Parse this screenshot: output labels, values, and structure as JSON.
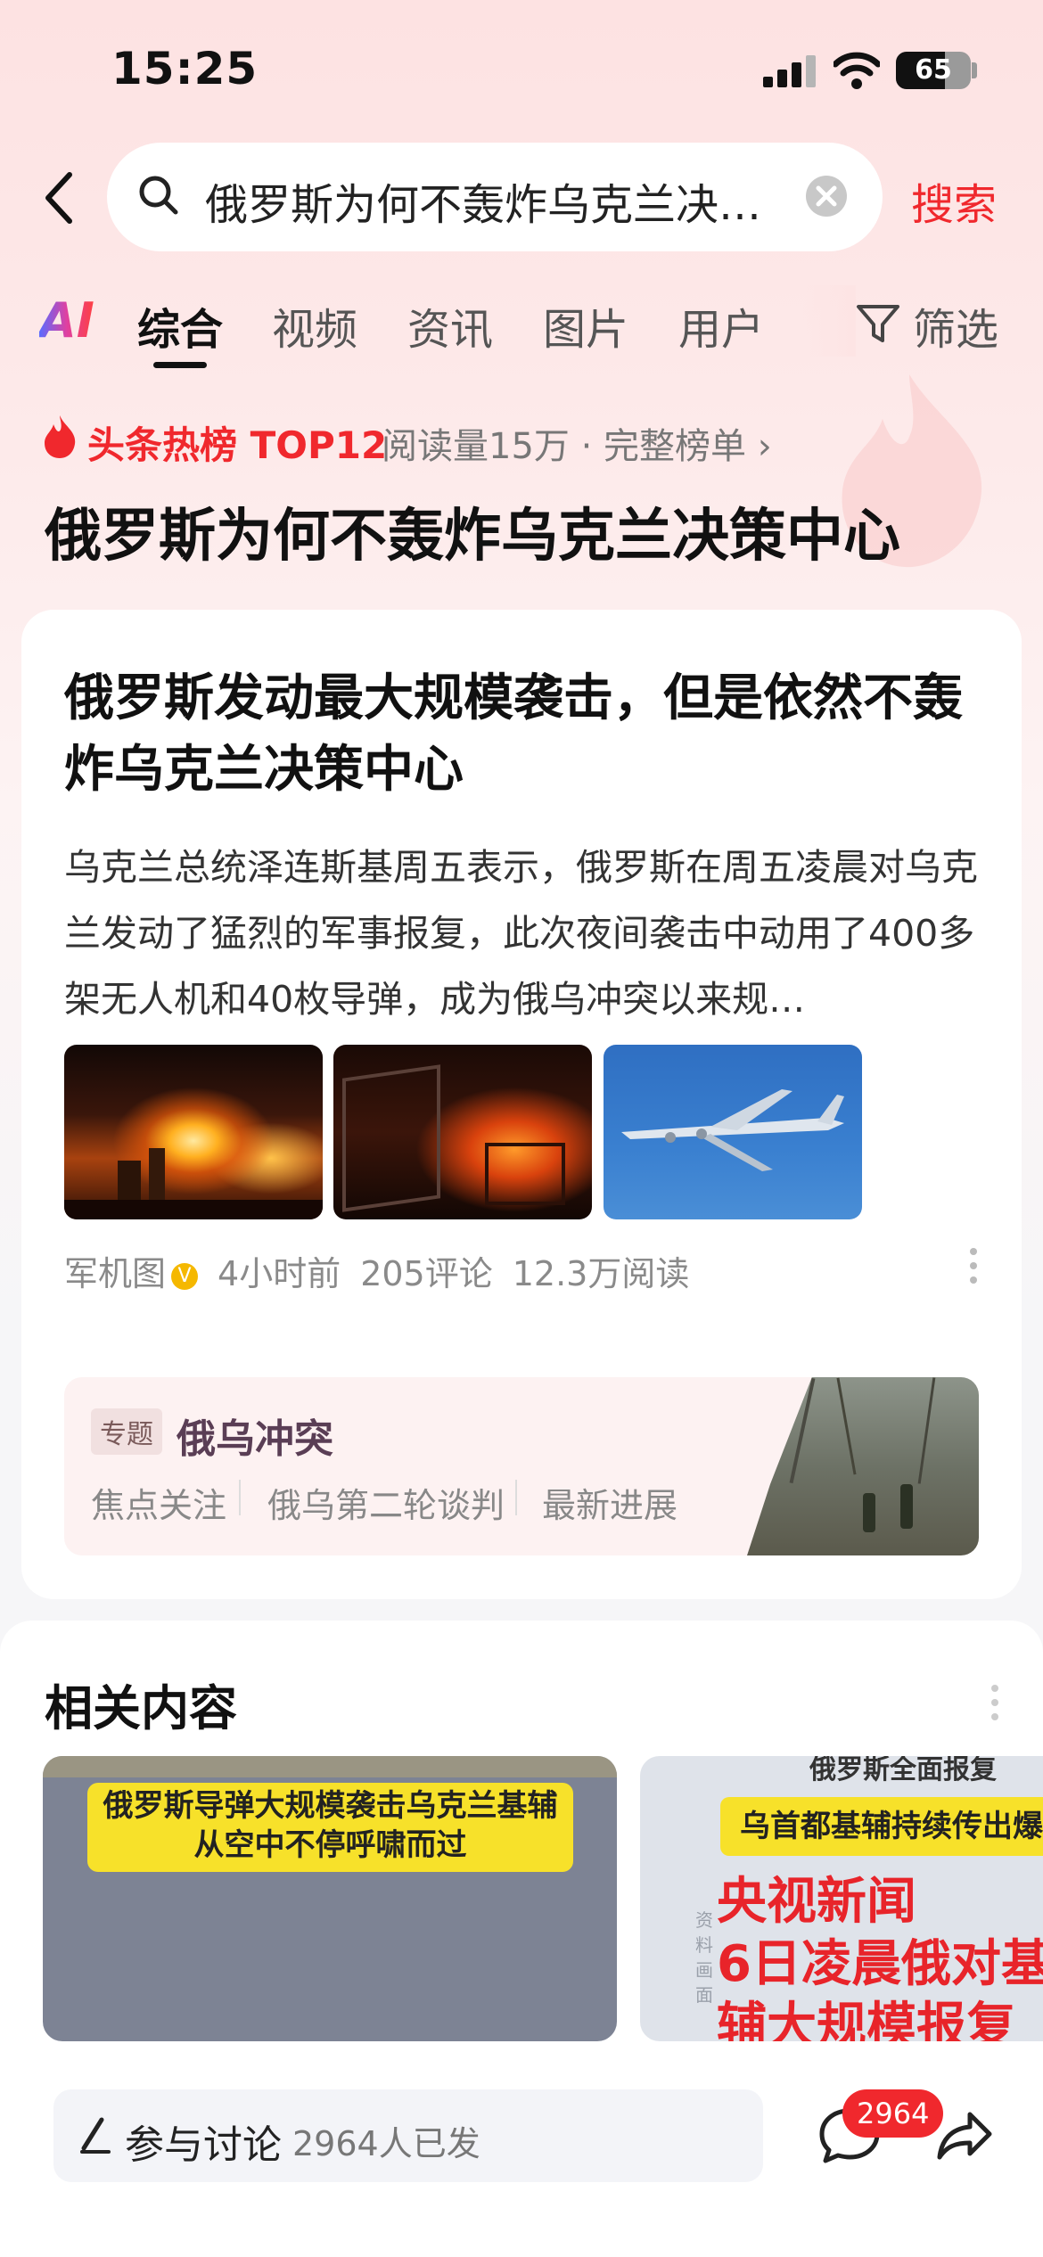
{
  "status_bar": {
    "time": "15:25",
    "battery": "65",
    "battery_level": 0.65
  },
  "search": {
    "query": "俄罗斯为何不轰炸乌克兰决…",
    "button": "搜索"
  },
  "tabs": {
    "ai": "AI",
    "items": [
      {
        "label": "综合",
        "active": true
      },
      {
        "label": "视频"
      },
      {
        "label": "资讯"
      },
      {
        "label": "图片"
      },
      {
        "label": "用户"
      }
    ],
    "filter": "筛选"
  },
  "hot": {
    "label": "头条热榜 TOP12",
    "meta": "阅读量15万 · 完整榜单 ›",
    "title": "俄罗斯为何不轰炸乌克兰决策中心"
  },
  "article": {
    "title": "俄罗斯发动最大规模袭击，但是依然不轰炸乌克兰决策中心",
    "summary": "乌克兰总统泽连斯基周五表示，俄罗斯在周五凌晨对乌克兰发动了猛烈的军事报复，此次夜间袭击中动用了400多架无人机和40枚导弹，成为俄乌冲突以来规…",
    "source": "军机图",
    "time": "4小时前",
    "comments": "205评论",
    "reads": "12.3万阅读"
  },
  "topic": {
    "tag": "专题",
    "title": "俄乌冲突",
    "links": [
      "焦点关注",
      "俄乌第二轮谈判",
      "最新进展"
    ]
  },
  "related": {
    "title": "相关内容",
    "videos": [
      {
        "caption": "俄罗斯导弹大规模袭击乌克兰基辅\n从空中不停呼啸而过"
      },
      {
        "top": "俄罗斯全面报复",
        "caption": "乌首都基辅持续传出爆",
        "headline1": "央视新闻",
        "headline2": "6日凌晨俄对基",
        "headline3": "辅大规模报复",
        "side": "资料画面"
      }
    ]
  },
  "bottom": {
    "discuss_label": "参与讨论",
    "discuss_count": "2964人已发",
    "comment_badge": "2964"
  },
  "colors": {
    "accent": "#f0282d",
    "background_top": "#fde2e2"
  }
}
